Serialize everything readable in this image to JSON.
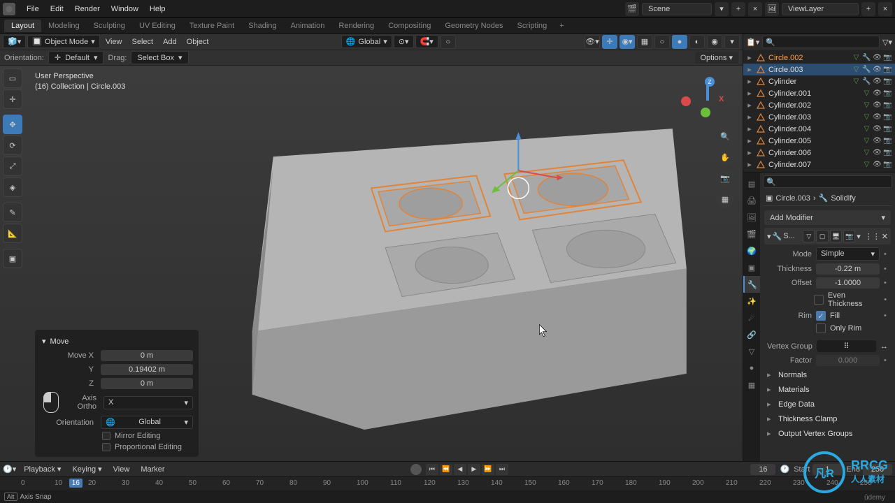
{
  "topmenu": {
    "items": [
      "File",
      "Edit",
      "Render",
      "Window",
      "Help"
    ],
    "scene_label": "Scene",
    "viewlayer_label": "ViewLayer"
  },
  "workspaces": [
    "Layout",
    "Modeling",
    "Sculpting",
    "UV Editing",
    "Texture Paint",
    "Shading",
    "Animation",
    "Rendering",
    "Compositing",
    "Geometry Nodes",
    "Scripting"
  ],
  "active_workspace": 0,
  "vp_header": {
    "mode": "Object Mode",
    "menus": [
      "View",
      "Select",
      "Add",
      "Object"
    ],
    "orientation": "Global"
  },
  "vp_sub": {
    "orientation_label": "Orientation:",
    "orientation_value": "Default",
    "drag_label": "Drag:",
    "drag_value": "Select Box",
    "options": "Options"
  },
  "viewport_info": {
    "line1": "User Perspective",
    "line2": "(16) Collection | Circle.003"
  },
  "move_panel": {
    "title": "Move",
    "rows": {
      "x_label": "Move X",
      "x_val": "0 m",
      "y_label": "Y",
      "y_val": "0.19402 m",
      "z_label": "Z",
      "z_val": "0 m",
      "axis_ortho_label": "Axis Ortho",
      "axis_ortho_val": "X",
      "orientation_label": "Orientation",
      "orientation_val": "Global",
      "mirror_label": "Mirror Editing",
      "prop_label": "Proportional Editing"
    }
  },
  "outliner": {
    "items": [
      {
        "name": "Circle.002",
        "active": true,
        "sel": false
      },
      {
        "name": "Circle.003",
        "active": false,
        "sel": true
      },
      {
        "name": "Cylinder",
        "active": false,
        "sel": false
      },
      {
        "name": "Cylinder.001",
        "active": false,
        "sel": false
      },
      {
        "name": "Cylinder.002",
        "active": false,
        "sel": false
      },
      {
        "name": "Cylinder.003",
        "active": false,
        "sel": false
      },
      {
        "name": "Cylinder.004",
        "active": false,
        "sel": false
      },
      {
        "name": "Cylinder.005",
        "active": false,
        "sel": false
      },
      {
        "name": "Cylinder.006",
        "active": false,
        "sel": false
      },
      {
        "name": "Cylinder.007",
        "active": false,
        "sel": false
      }
    ]
  },
  "props": {
    "breadcrumb_obj": "Circle.003",
    "breadcrumb_mod": "Solidify",
    "add_modifier": "Add Modifier",
    "mod_short": "S...",
    "mode_label": "Mode",
    "mode_val": "Simple",
    "thickness_label": "Thickness",
    "thickness_val": "-0.22 m",
    "offset_label": "Offset",
    "offset_val": "-1.0000",
    "even_label": "Even Thickness",
    "rim_label": "Rim",
    "fill_label": "Fill",
    "only_rim_label": "Only Rim",
    "vg_label": "Vertex Group",
    "factor_label": "Factor",
    "factor_val": "0.000",
    "sections": [
      "Normals",
      "Materials",
      "Edge Data",
      "Thickness Clamp",
      "Output Vertex Groups"
    ]
  },
  "timeline": {
    "menus": [
      "Playback",
      "Keying",
      "View",
      "Marker"
    ],
    "current": "16",
    "start_label": "Start",
    "start_val": "1",
    "end_label": "End",
    "end_val": "250",
    "ticks": [
      "0",
      "10",
      "16",
      "20",
      "30",
      "40",
      "50",
      "60",
      "70",
      "80",
      "90",
      "100",
      "110",
      "120",
      "130",
      "140",
      "150",
      "160",
      "170",
      "180",
      "190",
      "200",
      "210",
      "220",
      "230",
      "240",
      "250"
    ]
  },
  "statusbar": {
    "text": "Axis Snap"
  },
  "watermark": {
    "brand": "RRCG",
    "sub": "人人素材"
  },
  "udemy": "ûdemy"
}
